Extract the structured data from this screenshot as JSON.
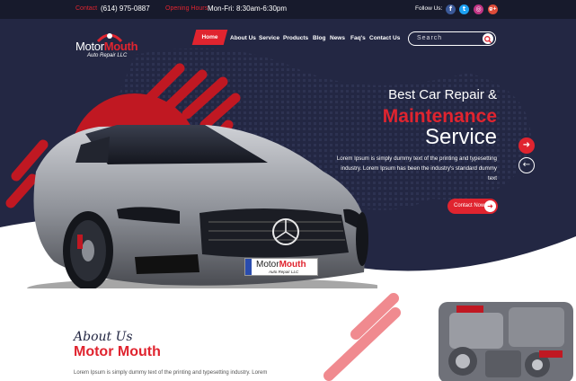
{
  "topbar": {
    "contact_label": "Contact",
    "phone": "(614) 975-0887",
    "hours_label": "Opening Hours",
    "hours": "Mon-Fri: 8:30am-6:30pm",
    "follow_label": "Follow Us:",
    "social": [
      {
        "name": "facebook",
        "glyph": "f",
        "color": "#3b5998"
      },
      {
        "name": "twitter",
        "glyph": "t",
        "color": "#1da1f2"
      },
      {
        "name": "instagram",
        "glyph": "◎",
        "color": "#c13584"
      },
      {
        "name": "google-plus",
        "glyph": "g+",
        "color": "#dd4b39"
      }
    ]
  },
  "logo": {
    "part1": "Motor",
    "part2": "Mouth",
    "tagline": "Auto Repair LLC"
  },
  "nav": {
    "items": [
      "Home",
      "About Us",
      "Service",
      "Products",
      "Blog",
      "News",
      "Faq's",
      "Contact Us"
    ],
    "active": "Home"
  },
  "search": {
    "placeholder": "Search"
  },
  "hero": {
    "line1": "Best Car Repair &",
    "line2": "Maintenance",
    "line3": "Service",
    "description": "Lorem Ipsum is simply dummy text of the printing and typesetting industry. Lorem Ipsum has been the industry's standard dummy text",
    "cta": "Contact Now",
    "plate_part1": "Motor",
    "plate_part2": "Mouth",
    "plate_tagline": "Auto Repair LLC"
  },
  "about": {
    "script": "About Us",
    "title": "Motor Mouth",
    "text": "Lorem Ipsum is simply dummy text of the printing and typesetting industry. Lorem"
  },
  "colors": {
    "accent": "#e0242f",
    "dark": "#232743",
    "topbar": "#171a2c"
  }
}
